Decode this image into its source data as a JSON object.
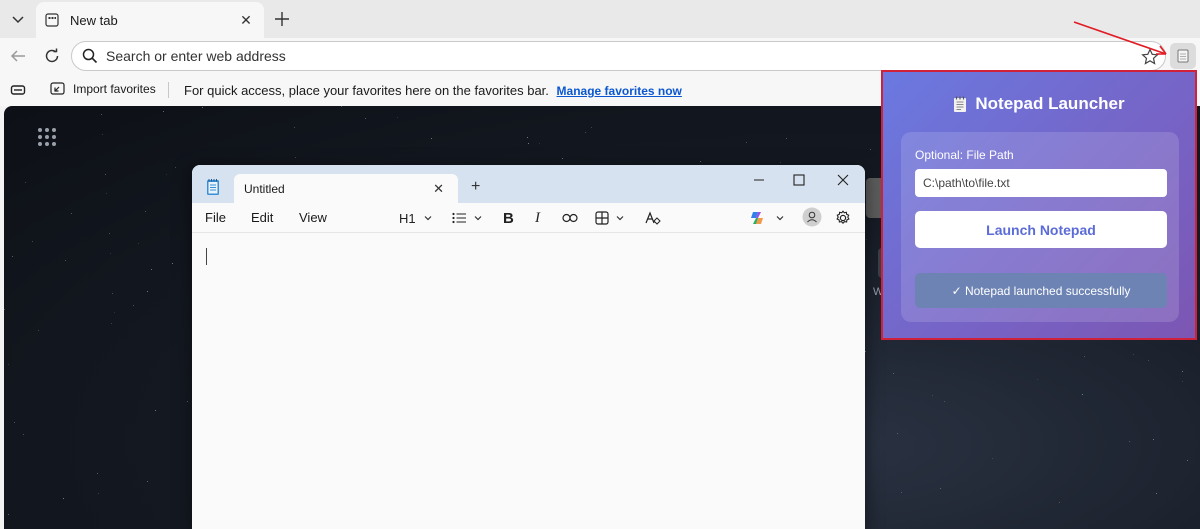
{
  "browser": {
    "tab": {
      "title": "New tab"
    },
    "address_bar": {
      "placeholder": "Search or enter web address"
    },
    "favorites_bar": {
      "import_label": "Import favorites",
      "message": "For quick access, place your favorites here on the favorites bar.",
      "manage_link": "Manage favorites now"
    }
  },
  "notepad": {
    "tab_title": "Untitled",
    "menus": [
      "File",
      "Edit",
      "View"
    ],
    "heading_selector": "H1"
  },
  "extension_popup": {
    "title": "Notepad Launcher",
    "title_icon": "notepad-icon",
    "file_path_label": "Optional: File Path",
    "file_path_placeholder": "C:\\path\\to\\file.txt",
    "launch_button": "Launch Notepad",
    "status": "✓ Notepad launched successfully"
  },
  "colors": {
    "popup_border": "#d0213b",
    "popup_gradient_start": "#6a79e0",
    "popup_gradient_end": "#7c56b3",
    "link": "#0b57d0",
    "arrow": "#e01b24"
  }
}
